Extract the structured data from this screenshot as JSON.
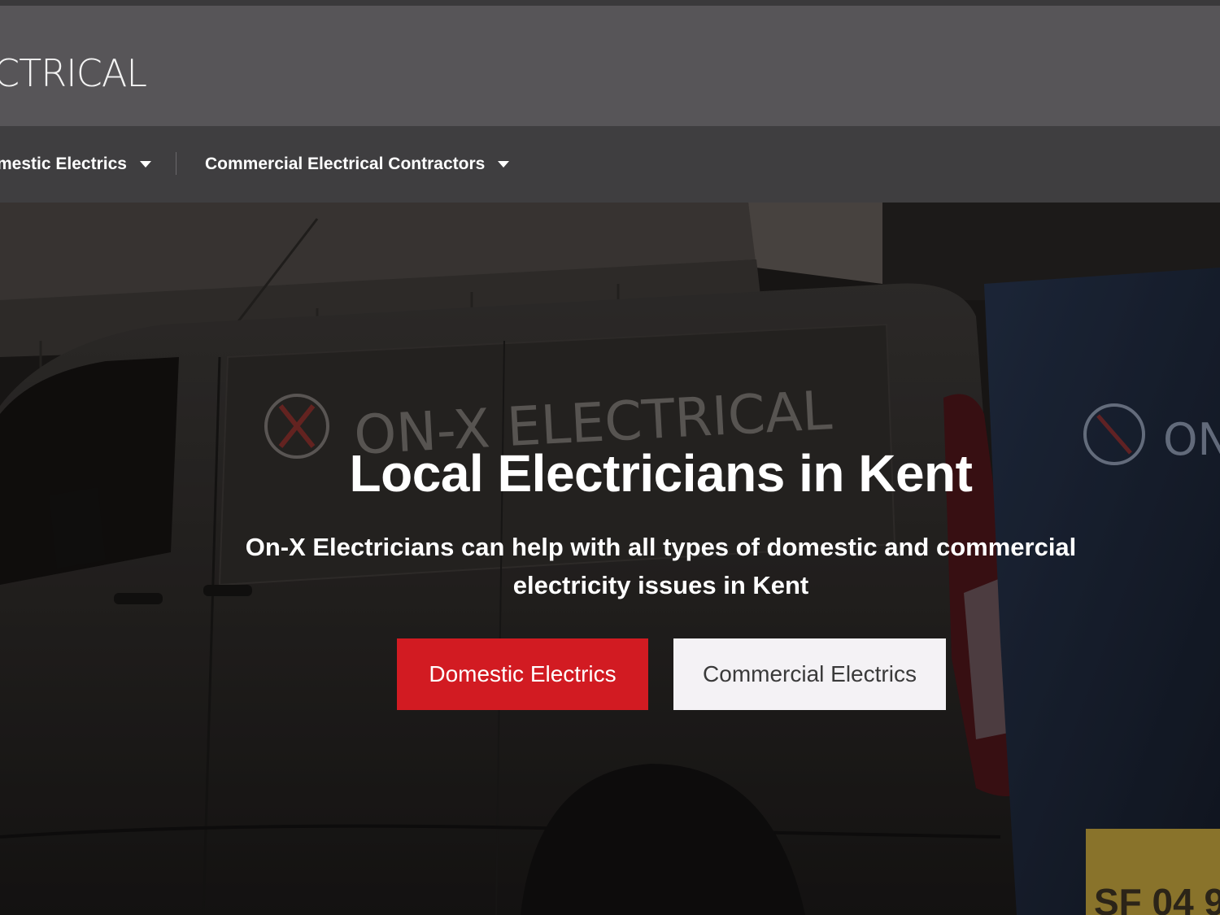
{
  "header": {
    "logo_text": "CTRICAL"
  },
  "nav": {
    "items": [
      {
        "label": "mestic Electrics"
      },
      {
        "label": "Commercial Electrical Contractors"
      }
    ]
  },
  "hero": {
    "title": "Local Electricians in Kent",
    "subtitle": "On-X Electricians can help with all types of domestic and commercial electricity issues in Kent",
    "buttons": {
      "domestic": "Domestic Electrics",
      "commercial": "Commercial Electrics"
    },
    "van_logo_text": "ON-X ELECTRICAL",
    "van_logo_text_right": "ON",
    "plate_text": "SF 04 9"
  },
  "colors": {
    "header_bg": "#575558",
    "nav_bg": "#3f3e40",
    "accent_red": "#d21b22",
    "button_light": "#f4f2f5"
  }
}
